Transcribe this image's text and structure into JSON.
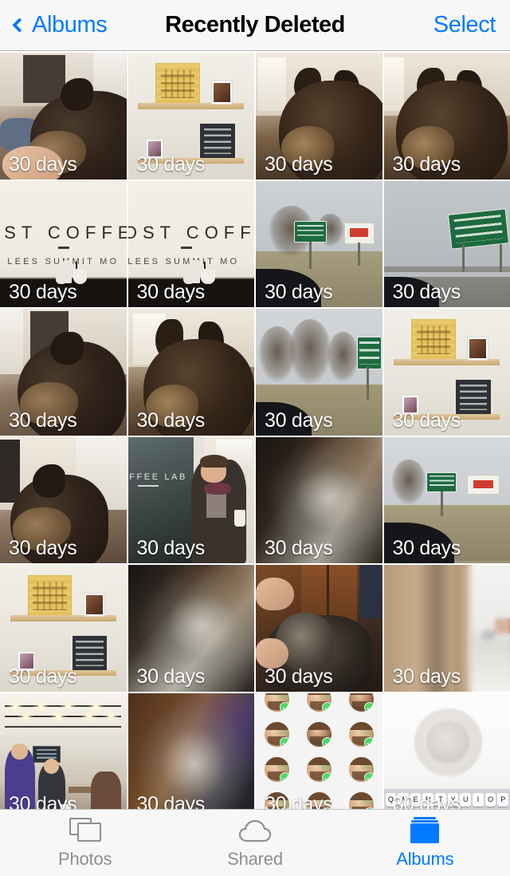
{
  "app": "Photos",
  "navbar": {
    "back_label": "Albums",
    "back_icon": "chevron-left-icon",
    "title": "Recently Deleted",
    "select_label": "Select"
  },
  "grid": {
    "columns": 4,
    "expiry_label": "30 days",
    "photos": [
      {
        "id": 1,
        "scene": "dog-close-up-on-floor",
        "days": "30 days"
      },
      {
        "id": 2,
        "scene": "wall-ledge-poster-letterboard",
        "days": "30 days"
      },
      {
        "id": 3,
        "scene": "dog-head-by-window",
        "days": "30 days"
      },
      {
        "id": 4,
        "scene": "dog-head-profile",
        "days": "30 days"
      },
      {
        "id": 5,
        "scene": "coffee-shop-sign",
        "days": "30 days",
        "sign_text": "OST COFFEE",
        "sign_subtext": "LEES SUMMIT MO"
      },
      {
        "id": 6,
        "scene": "coffee-shop-sign",
        "days": "30 days",
        "sign_text": "COST COFFEE  C",
        "sign_subtext": "LEES SUMMIT MO"
      },
      {
        "id": 7,
        "scene": "highway-green-sign-billboard",
        "days": "30 days"
      },
      {
        "id": 8,
        "scene": "highway-overhead-green-sign",
        "days": "30 days"
      },
      {
        "id": 9,
        "scene": "dog-looking-left",
        "days": "30 days"
      },
      {
        "id": 10,
        "scene": "dog-ears-up",
        "days": "30 days"
      },
      {
        "id": 11,
        "scene": "bare-trees-roadside-sign",
        "days": "30 days"
      },
      {
        "id": 12,
        "scene": "wall-ledge-poster-letterboard",
        "days": "30 days"
      },
      {
        "id": 13,
        "scene": "dog-lying-by-window",
        "days": "30 days"
      },
      {
        "id": 14,
        "scene": "person-by-coffee-lab-window",
        "days": "30 days",
        "window_text": "OFFEE LAB"
      },
      {
        "id": 15,
        "scene": "blurry-dark-motion",
        "days": "30 days"
      },
      {
        "id": 16,
        "scene": "highway-from-car-window",
        "days": "30 days"
      },
      {
        "id": 17,
        "scene": "wall-ledge-poster-letterboard",
        "days": "30 days"
      },
      {
        "id": 18,
        "scene": "blurry-dark-motion",
        "days": "30 days"
      },
      {
        "id": 19,
        "scene": "hand-petting-dog-indoors",
        "days": "30 days"
      },
      {
        "id": 20,
        "scene": "blurry-doorway-window",
        "days": "30 days"
      },
      {
        "id": 21,
        "scene": "cafe-interior-with-people",
        "days": "30 days"
      },
      {
        "id": 22,
        "scene": "blurry-motion-wood-floor",
        "days": "30 days"
      },
      {
        "id": 23,
        "scene": "screenshot-avatar-grid",
        "days": "30 days"
      },
      {
        "id": 24,
        "scene": "screenshot-with-keyboard",
        "days": "30 days",
        "keyboard_row": [
          "Q",
          "W",
          "E",
          "R",
          "T",
          "Y",
          "U",
          "I",
          "O",
          "P"
        ]
      }
    ]
  },
  "tabbar": {
    "tabs": [
      {
        "id": "photos",
        "label": "Photos",
        "icon": "photos-stack-icon",
        "active": false
      },
      {
        "id": "shared",
        "label": "Shared",
        "icon": "cloud-icon",
        "active": false
      },
      {
        "id": "albums",
        "label": "Albums",
        "icon": "albums-folder-icon",
        "active": true
      }
    ]
  },
  "colors": {
    "accent": "#007aff",
    "bar_background": "#f7f7f7",
    "inactive_tab": "#8e8e93",
    "title": "#000000"
  }
}
